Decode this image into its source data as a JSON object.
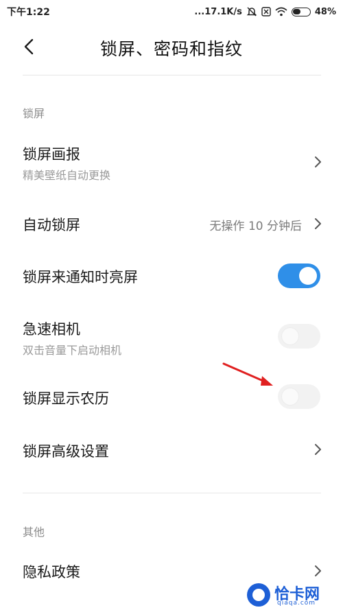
{
  "status_bar": {
    "time": "下午1:22",
    "network_speed": "...17.1K/s",
    "battery_percent": "48%",
    "icons": [
      "mute-icon",
      "sim-off-icon",
      "wifi-icon",
      "battery-icon"
    ]
  },
  "header": {
    "back_icon": "chevron-left-icon",
    "title": "锁屏、密码和指纹"
  },
  "sections": [
    {
      "label": "锁屏",
      "items": [
        {
          "title": "锁屏画报",
          "subtitle": "精美壁纸自动更换",
          "control": "chevron"
        },
        {
          "title": "自动锁屏",
          "value": "无操作 10 分钟后",
          "control": "chevron"
        },
        {
          "title": "锁屏来通知时亮屏",
          "control": "toggle",
          "toggle_on": true
        },
        {
          "title": "急速相机",
          "subtitle": "双击音量下启动相机",
          "control": "toggle",
          "toggle_on": false
        },
        {
          "title": "锁屏显示农历",
          "control": "toggle",
          "toggle_on": false
        },
        {
          "title": "锁屏高级设置",
          "control": "chevron"
        }
      ]
    },
    {
      "label": "其他",
      "items": [
        {
          "title": "隐私政策",
          "control": "chevron"
        }
      ]
    }
  ],
  "watermark": {
    "text": "恰卡网",
    "sub": "qiaqa.com"
  },
  "colors": {
    "accent": "#2f8fe8",
    "annotation_arrow": "#e02020"
  }
}
